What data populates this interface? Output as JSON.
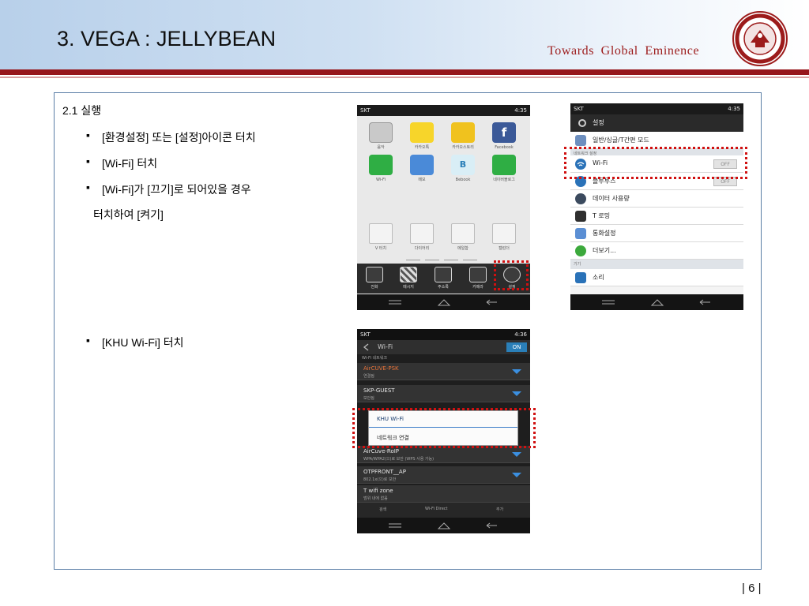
{
  "header": {
    "title": "3. VEGA : JELLYBEAN",
    "tagline": "Towards  Global  Eminence",
    "colors": {
      "accent_red": "#96161b",
      "header_blue": "#b8d0ea"
    }
  },
  "content": {
    "section_title": "2.1 실행",
    "bullets": [
      "[환경설정] 또는 [설정]아이콘 터치",
      "[Wi-Fi] 터치",
      "[Wi-Fi]가 [끄기]로 되어있을 경우",
      "[KHU Wi-Fi] 터치"
    ],
    "bullet3_continued": "터치하여 [켜기]"
  },
  "phone_launcher": {
    "status_carrier": "SKT",
    "status_time": "4:35",
    "apps_row1": [
      "음악",
      "카카오톡",
      "카카오스토리",
      "Facebook"
    ],
    "apps_row2": [
      "Wi-Fi",
      "메모",
      "Bebook",
      "네이버블로그"
    ],
    "apps_row3": [
      "V 터치",
      "다이어리",
      "메일함",
      "캘린더"
    ],
    "dock": [
      "전화",
      "메시지",
      "주소록",
      "카메라",
      "설정"
    ]
  },
  "phone_settings": {
    "status_carrier": "SKT",
    "status_time": "4:35",
    "header": "설정",
    "rows": [
      "일반/싱글/T간편 모드",
      "Wi-Fi",
      "블루투스",
      "데이터 사용량",
      "T 로밍",
      "통화설정",
      "더보기..."
    ],
    "category_network": "네트워크 설정",
    "category_device": "기기",
    "row_sound": "소리",
    "toggle_off": "OFF"
  },
  "phone_wifi": {
    "status_carrier": "SKT",
    "status_time": "4:36",
    "header": "Wi-Fi",
    "on_label": "ON",
    "section": "Wi-Fi 네트워크",
    "networks": [
      {
        "name": "AirCUVE-PSK",
        "sub": "연결됨"
      },
      {
        "name": "SKP-GUEST",
        "sub": "보안됨"
      },
      {
        "name": "AirCuve-RoIP",
        "sub": "WPA/WPA2(으)로 보안 (WPS 사용 가능)"
      },
      {
        "name": "OTPFRONT__AP",
        "sub": "802.1x(으)로 보안"
      },
      {
        "name": "T wifi zone",
        "sub": "범위 내에 없음"
      }
    ],
    "popup_title": "KHU Wi-Fi",
    "popup_item": "네트워크 연결",
    "bottom_buttons": [
      "검색",
      "Wi-Fi Direct",
      "추가"
    ]
  },
  "footer": {
    "page": "| 6 |"
  }
}
